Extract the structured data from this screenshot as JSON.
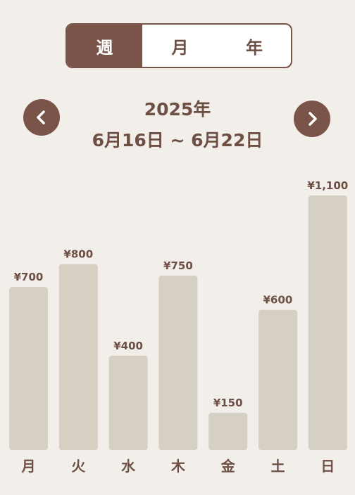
{
  "tabs": [
    {
      "label": "週",
      "active": true
    },
    {
      "label": "月",
      "active": false
    },
    {
      "label": "年",
      "active": false
    }
  ],
  "period": {
    "year": "2025年",
    "range": "6月16日 ~ 6月22日"
  },
  "nav": {
    "prev_icon": "chevron-left-icon",
    "next_icon": "chevron-right-icon"
  },
  "colors": {
    "accent": "#7a5448",
    "bar": "#d6cfc3",
    "background": "#f2efea",
    "text": "#6e4f43"
  },
  "chart_data": {
    "type": "bar",
    "categories": [
      "月",
      "火",
      "水",
      "木",
      "金",
      "土",
      "日"
    ],
    "values": [
      700,
      800,
      400,
      750,
      150,
      600,
      1100
    ],
    "value_labels": [
      "¥700",
      "¥800",
      "¥400",
      "¥750",
      "¥150",
      "¥600",
      "¥1,100"
    ],
    "ylim": [
      0,
      1100
    ],
    "grid": false
  }
}
